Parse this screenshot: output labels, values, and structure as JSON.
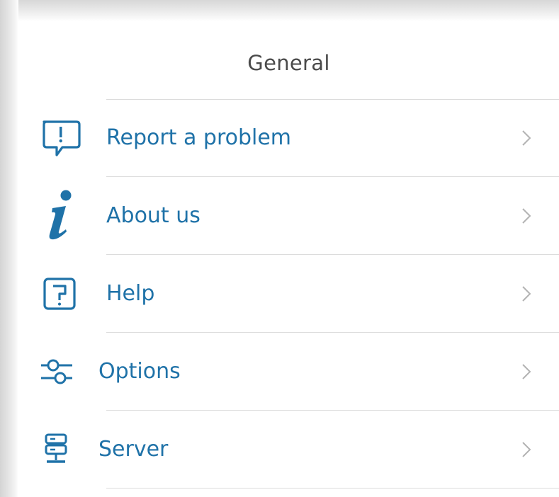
{
  "section": {
    "title": "General"
  },
  "menu": {
    "items": [
      {
        "id": "report",
        "label": "Report a problem",
        "icon": "report-problem-icon"
      },
      {
        "id": "about",
        "label": "About us",
        "icon": "info-icon"
      },
      {
        "id": "help",
        "label": "Help",
        "icon": "help-question-icon"
      },
      {
        "id": "options",
        "label": "Options",
        "icon": "options-sliders-icon"
      },
      {
        "id": "server",
        "label": "Server",
        "icon": "server-icon"
      }
    ]
  },
  "colors": {
    "accent": "#1f72a8",
    "title_text": "#4a4a4a",
    "divider": "#dcdcdc",
    "chevron": "#b3b3b3"
  }
}
